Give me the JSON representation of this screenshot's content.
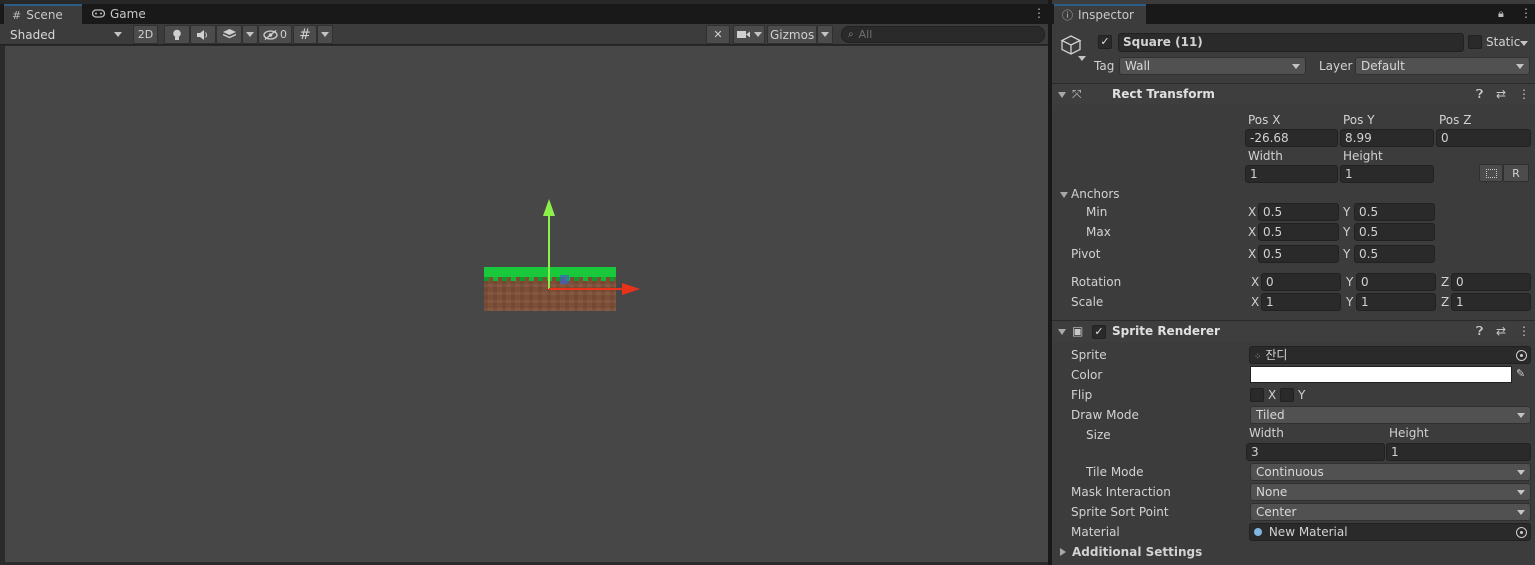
{
  "scene_tabs": {
    "scene": {
      "label": "Scene",
      "icon": "grid-icon"
    },
    "game": {
      "label": "Game",
      "icon": "gamepad-icon"
    }
  },
  "scene_toolbar": {
    "shading_mode": "Shaded",
    "mode_2d": "2D",
    "hidden_count": "0",
    "gizmos": "Gizmos",
    "search_placeholder": "All"
  },
  "inspector": {
    "tab_label": "Inspector",
    "object": {
      "name": "Square (11)",
      "active": true,
      "static_label": "Static",
      "tag_label": "Tag",
      "tag_value": "Wall",
      "layer_label": "Layer",
      "layer_value": "Default"
    },
    "rect_transform": {
      "title": "Rect Transform",
      "pos_x_label": "Pos X",
      "pos_x": "-26.68",
      "pos_y_label": "Pos Y",
      "pos_y": "8.99",
      "pos_z_label": "Pos Z",
      "pos_z": "0",
      "width_label": "Width",
      "width": "1",
      "height_label": "Height",
      "height": "1",
      "r_button": "R",
      "anchors_label": "Anchors",
      "min_label": "Min",
      "min_x": "0.5",
      "min_y": "0.5",
      "max_label": "Max",
      "max_x": "0.5",
      "max_y": "0.5",
      "pivot_label": "Pivot",
      "pivot_x": "0.5",
      "pivot_y": "0.5",
      "rotation_label": "Rotation",
      "rot_x": "0",
      "rot_y": "0",
      "rot_z": "0",
      "scale_label": "Scale",
      "scale_x": "1",
      "scale_y": "1",
      "scale_z": "1",
      "axis_x": "X",
      "axis_y": "Y",
      "axis_z": "Z"
    },
    "sprite_renderer": {
      "title": "Sprite Renderer",
      "enabled": true,
      "sprite_label": "Sprite",
      "sprite_value": "잔디",
      "color_label": "Color",
      "color_value": "#ffffff",
      "flip_label": "Flip",
      "flip_x": "X",
      "flip_y": "Y",
      "draw_mode_label": "Draw Mode",
      "draw_mode": "Tiled",
      "size_label": "Size",
      "size_width_label": "Width",
      "size_width": "3",
      "size_height_label": "Height",
      "size_height": "1",
      "tile_mode_label": "Tile Mode",
      "tile_mode": "Continuous",
      "mask_label": "Mask Interaction",
      "mask_value": "None",
      "sort_point_label": "Sprite Sort Point",
      "sort_point": "Center",
      "material_label": "Material",
      "material_value": "New Material",
      "additional_settings": "Additional Settings"
    }
  },
  "colors": {
    "axis_y": "#8cf04a",
    "axis_x": "#e8321a",
    "grass": "#19c93b",
    "dirt": "#7d4f37",
    "accent": "#2c5d87"
  }
}
